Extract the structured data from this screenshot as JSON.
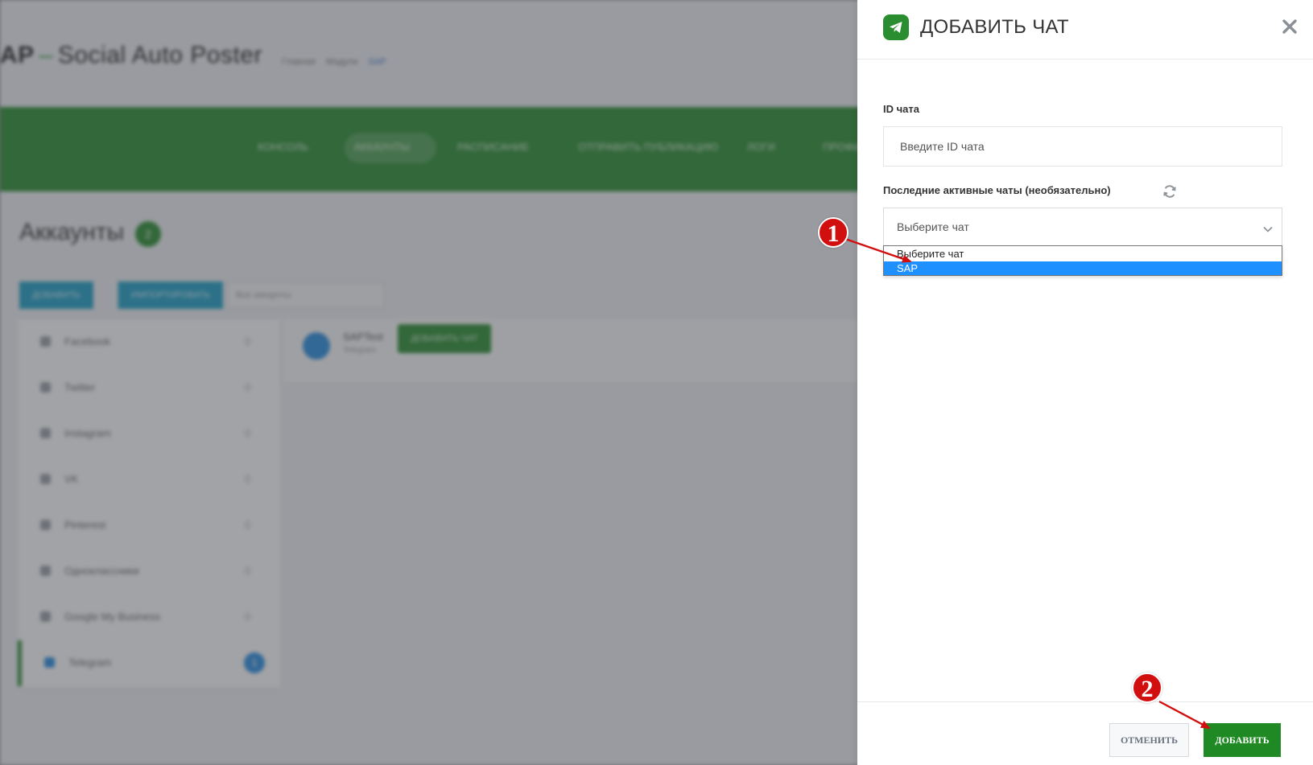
{
  "background": {
    "app_title_short": "AP",
    "app_title_rest": "Social Auto Poster",
    "breadcrumbs": [
      "Главная",
      "Модули",
      "SAP"
    ],
    "nav_items": [
      "КОНСОЛЬ",
      "АККАУНТЫ",
      "РАСПИСАНИЕ",
      "ОТПРАВИТЬ ПУБЛИКАЦИЮ",
      "ЛОГИ",
      "ПРОФИЛЬ"
    ],
    "page_heading": "Аккаунты",
    "page_heading_count": "2",
    "tool_buttons": [
      "ДОБАВИТЬ",
      "ИМПОРТИРОВАТЬ"
    ],
    "filter_placeholder": "Все аккаунты",
    "sidebar_items": [
      {
        "label": "Facebook",
        "count": "0"
      },
      {
        "label": "Twitter",
        "count": "0"
      },
      {
        "label": "Instagram",
        "count": "0"
      },
      {
        "label": "VK",
        "count": "0"
      },
      {
        "label": "Pinterest",
        "count": "0"
      },
      {
        "label": "Одноклассники",
        "count": "0"
      },
      {
        "label": "Google My Business",
        "count": "0"
      },
      {
        "label": "Telegram",
        "count": "1"
      }
    ],
    "account_name": "SAPTest",
    "account_sub": "Telegram",
    "account_button": "ДОБАВИТЬ ЧАТ"
  },
  "drawer": {
    "title": "ДОБАВИТЬ ЧАТ",
    "chat_id_label": "ID чата",
    "chat_id_placeholder": "Введите ID чата",
    "chat_id_value": "",
    "recent_label": "Последние активные чаты (необязательно)",
    "select_value": "Выберите чат",
    "options": [
      "Выберите чат",
      "SAP"
    ],
    "selected_option": "SAP",
    "cancel_label": "ОТМЕНИТЬ",
    "add_label": "ДОБАВИТЬ"
  },
  "annotations": [
    {
      "number": "1"
    },
    {
      "number": "2"
    }
  ],
  "colors": {
    "brand_green": "#2a8e30",
    "add_button": "#1f8a24",
    "highlight_blue": "#1e90ff",
    "annotation_red": "#d20f0f"
  }
}
